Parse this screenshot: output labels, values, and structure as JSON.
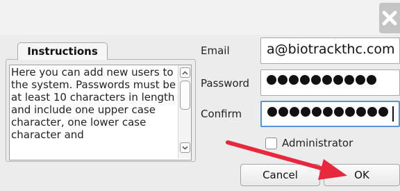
{
  "window": {
    "close_icon": "close-icon"
  },
  "instructions": {
    "tab_label": "Instructions",
    "text": "Here you can add new users to the system. Passwords must be at least 10 characters in length and include one upper case character, one lower case character and"
  },
  "form": {
    "email_label": "Email",
    "email_value": "a@biotrackthc.com",
    "password_label": "Password",
    "password_dots": 10,
    "confirm_label": "Confirm",
    "confirm_dots": 11,
    "administrator_label": "Administrator",
    "administrator_checked": false
  },
  "buttons": {
    "cancel_label": "Cancel",
    "ok_label": "OK"
  },
  "annotation": {
    "arrow_color": "#e8283c",
    "arrow_points_to": "ok-button"
  },
  "colors": {
    "focus_border": "#5a92d6",
    "panel_bg": "#ececec"
  }
}
